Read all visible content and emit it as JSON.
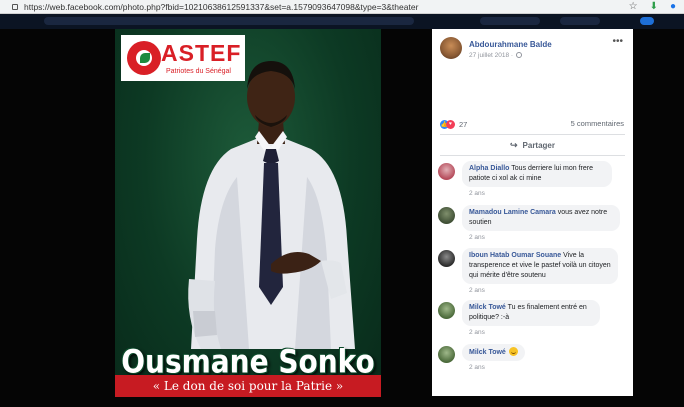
{
  "browser": {
    "url": "https://web.facebook.com/photo.php?fbid=10210638612591337&set=a.1579093647098&type=3&theater"
  },
  "photo": {
    "logo_title": "ASTEF",
    "logo_subtitle": "Patriotes du Sénégal",
    "candidate_name": "Ousmane Sonko",
    "slogan": "« Le don de soi pour la Patrie »",
    "colors": {
      "green": "#0f3d26",
      "red": "#c71b22",
      "white": "#ffffff"
    }
  },
  "post": {
    "author": "Abdourahmane Balde",
    "date": "27 juillet 2018 ·",
    "reaction_count": "27",
    "comment_count": "5 commentaires",
    "share_label": "Partager"
  },
  "comments": [
    {
      "author": "Alpha Diallo",
      "text": "Tous derriere lui mon frere patiote ci xol ak ci mine",
      "time": "2 ans"
    },
    {
      "author": "Mamadou Lamine Camara",
      "text": "vous avez notre soutien",
      "time": "2 ans"
    },
    {
      "author": "Iboun Hatab Oumar Souane",
      "text": "Vive la transperence et vive le pastef voilà un citoyen qui mérite d'être soutenu",
      "time": "2 ans"
    },
    {
      "author": "Milck Towé",
      "text": "Tu es finalement entré en politique? :-à",
      "time": "2 ans"
    },
    {
      "author": "Milck Towé",
      "text": "",
      "time": "2 ans"
    }
  ],
  "icons": {
    "lock": "lock-icon",
    "star": "star-icon",
    "extension": "extension-icon",
    "profile": "profile-icon",
    "more": "more-options-icon",
    "like": "like-icon",
    "share": "share-icon"
  }
}
